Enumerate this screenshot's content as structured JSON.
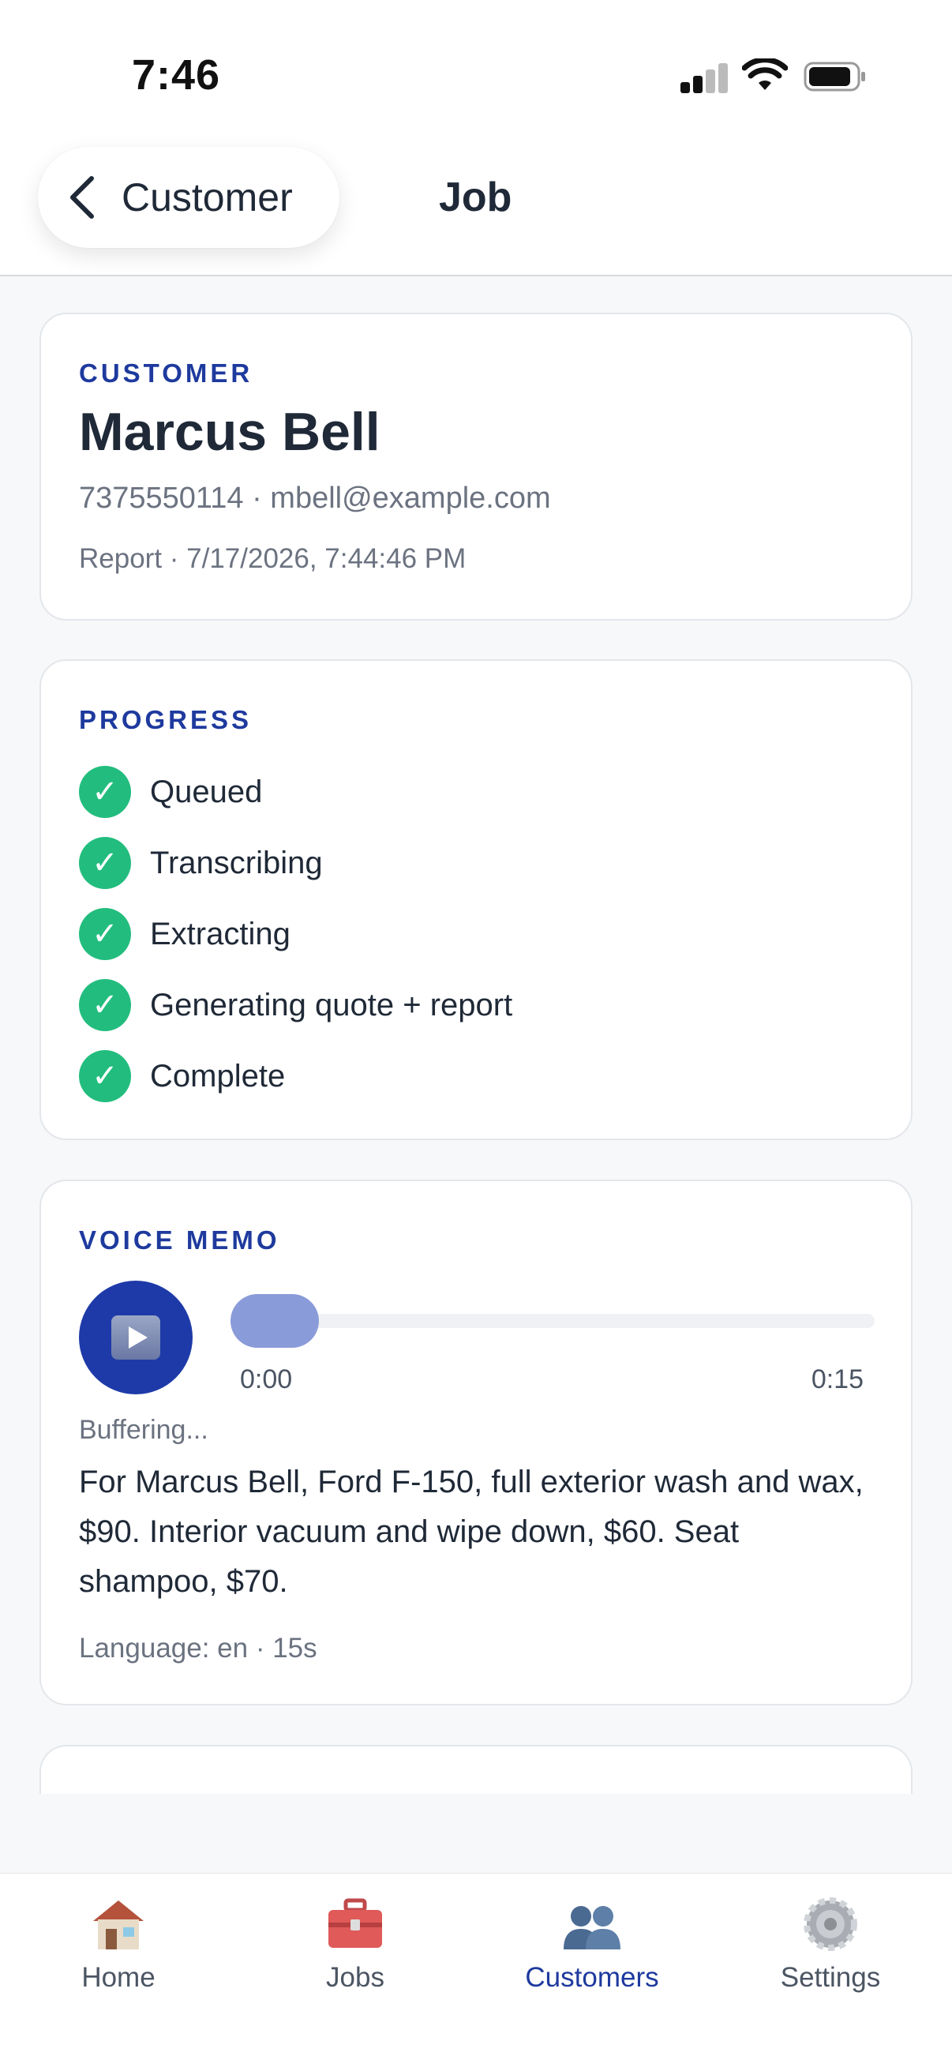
{
  "status_bar": {
    "time": "7:46"
  },
  "nav": {
    "back_label": "Customer",
    "title": "Job"
  },
  "customer_card": {
    "section_label": "CUSTOMER",
    "name": "Marcus Bell",
    "contact": "7375550114 · mbell@example.com",
    "report": "Report · 7/17/2026, 7:44:46 PM"
  },
  "progress_card": {
    "section_label": "PROGRESS",
    "steps": [
      {
        "label": "Queued",
        "done": true
      },
      {
        "label": "Transcribing",
        "done": true
      },
      {
        "label": "Extracting",
        "done": true
      },
      {
        "label": "Generating quote + report",
        "done": true
      },
      {
        "label": "Complete",
        "done": true
      }
    ],
    "check_glyph": "✓"
  },
  "voice_memo_card": {
    "section_label": "VOICE MEMO",
    "time_start": "0:00",
    "time_end": "0:15",
    "playback_fraction": 0.0,
    "status": "Buffering...",
    "transcript": "For Marcus Bell, Ford F-150, full exterior wash and wax, $90. Interior vacuum and wipe down, $60. Seat shampoo, $70.",
    "meta": "Language: en · 15s"
  },
  "tab_bar": {
    "tabs": [
      {
        "label": "Home",
        "icon": "home-icon"
      },
      {
        "label": "Jobs",
        "icon": "toolbox-icon"
      },
      {
        "label": "Customers",
        "icon": "people-icon",
        "active": true
      },
      {
        "label": "Settings",
        "icon": "gear-icon"
      }
    ]
  },
  "colors": {
    "accent": "#1e3a9e",
    "success": "#22bd7e",
    "play_button": "#1e3aa8",
    "slider_thumb": "#8a9bd9"
  }
}
